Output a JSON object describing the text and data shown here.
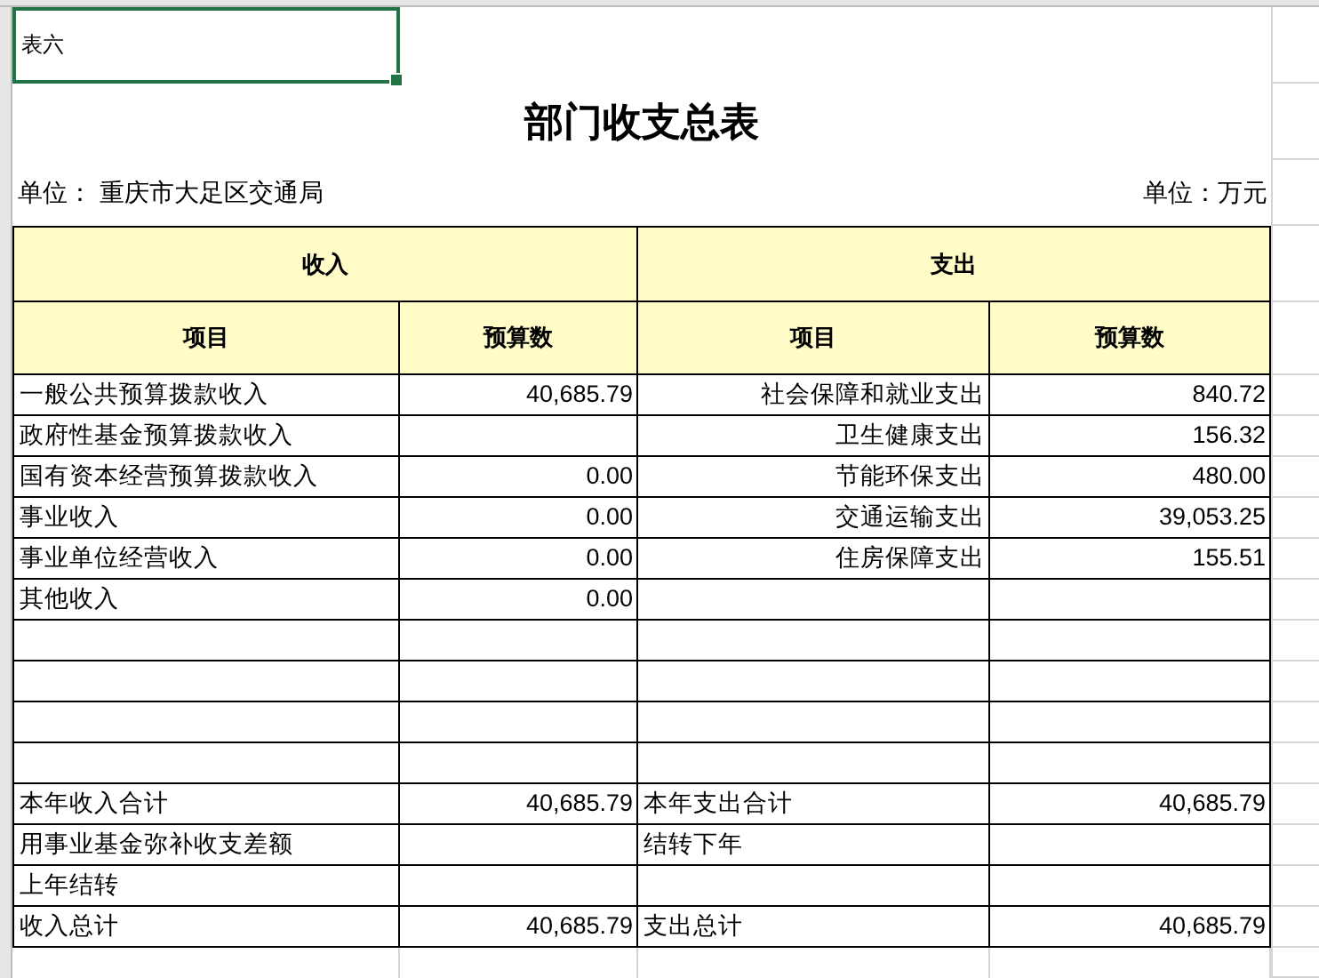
{
  "sheet_label": {
    "text": "表六",
    "selected": true
  },
  "title": "部门收支总表",
  "unit_left": "单位： 重庆市大足区交通局",
  "unit_right": "单位：万元",
  "group_headers": [
    "收入",
    "支出"
  ],
  "column_headers": [
    "项目",
    "预算数",
    "项目",
    "预算数"
  ],
  "rows": [
    {
      "kind": "detail",
      "income_item": "一般公共预算拨款收入",
      "income_amount": "40,685.79",
      "expense_item": "社会保障和就业支出",
      "expense_amount": "840.72"
    },
    {
      "kind": "detail",
      "income_item": "政府性基金预算拨款收入",
      "expense_item": "卫生健康支出",
      "expense_amount": "156.32"
    },
    {
      "kind": "detail",
      "income_item": "国有资本经营预算拨款收入",
      "income_amount": "0.00",
      "expense_item": "节能环保支出",
      "expense_amount": "480.00"
    },
    {
      "kind": "detail",
      "income_item": "事业收入",
      "income_amount": "0.00",
      "expense_item": "交通运输支出",
      "expense_amount": "39,053.25"
    },
    {
      "kind": "detail",
      "income_item": "事业单位经营收入",
      "income_amount": "0.00",
      "expense_item": "住房保障支出",
      "expense_amount": "155.51"
    },
    {
      "kind": "detail",
      "income_item": "其他收入",
      "income_amount": "0.00"
    },
    {
      "kind": "detail"
    },
    {
      "kind": "detail"
    },
    {
      "kind": "detail"
    },
    {
      "kind": "detail"
    },
    {
      "kind": "total",
      "income_item": "本年收入合计",
      "income_amount": "40,685.79",
      "expense_item": "本年支出合计",
      "expense_amount": "40,685.79"
    },
    {
      "kind": "total",
      "income_item": "用事业基金弥补收支差额",
      "expense_item": "结转下年"
    },
    {
      "kind": "total",
      "income_item": "上年结转"
    },
    {
      "kind": "total",
      "income_item": "收入总计",
      "income_amount": "40,685.79",
      "expense_item": "支出总计",
      "expense_amount": "40,685.79"
    }
  ]
}
